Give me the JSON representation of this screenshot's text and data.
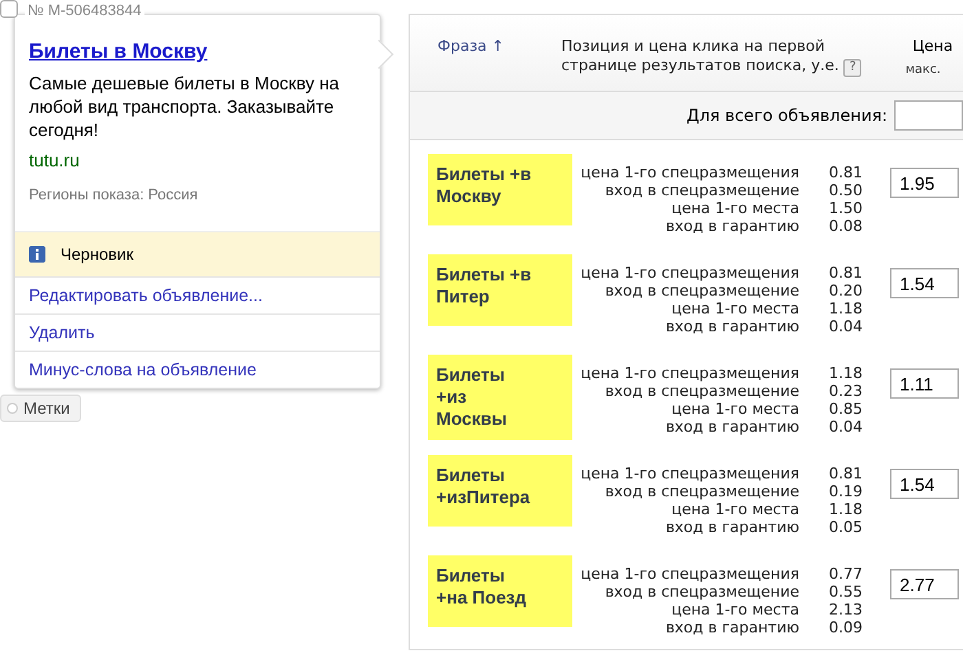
{
  "ad": {
    "checked": false,
    "number": "№ M-506483844",
    "title": "Билеты в Москву",
    "text": "Самые дешевые билеты в Москву на любой вид транспорта. Заказывайте сегодня!",
    "domain": "tutu.ru",
    "regions": "Регионы показа: Россия",
    "status": "Черновик",
    "actions": [
      "Редактировать объявление...",
      "Удалить",
      "Минус-слова на объявление"
    ]
  },
  "labels_button": "Метки",
  "table": {
    "columns": {
      "phrase": "Фраза",
      "sort_mark": "↑",
      "position": "Позиция и цена клика на первой странице результатов поиска, у.е.",
      "help": "?",
      "price": "Цена",
      "price_sub": "макс."
    },
    "all_ad_label": "Для всего объявления:",
    "rows": [
      {
        "phrase": "Билеты +в\nМоскву",
        "stats": [
          {
            "label": "цена 1-го спецразмещения",
            "value": "0.81"
          },
          {
            "label": "вход в спецразмещение",
            "value": "0.50"
          },
          {
            "label": "цена 1-го места",
            "value": "1.50"
          },
          {
            "label": "вход в гарантию",
            "value": "0.08"
          }
        ],
        "price": "1.95"
      },
      {
        "phrase": "Билеты +в\nПитер",
        "stats": [
          {
            "label": "цена 1-го спецразмещения",
            "value": "0.81"
          },
          {
            "label": "вход в спецразмещение",
            "value": "0.20"
          },
          {
            "label": "цена 1-го места",
            "value": "1.18"
          },
          {
            "label": "вход в гарантию",
            "value": "0.04"
          }
        ],
        "price": "1.54"
      },
      {
        "phrase": "Билеты\n+из\nМосквы",
        "stats": [
          {
            "label": "цена 1-го спецразмещения",
            "value": "1.18"
          },
          {
            "label": "вход в спецразмещение",
            "value": "0.23"
          },
          {
            "label": "цена 1-го места",
            "value": "0.85"
          },
          {
            "label": "вход в гарантию",
            "value": "0.04"
          }
        ],
        "price": "1.11"
      },
      {
        "phrase": "Билеты\n+изПитера",
        "stats": [
          {
            "label": "цена 1-го спецразмещения",
            "value": "0.81"
          },
          {
            "label": "вход в спецразмещение",
            "value": "0.19"
          },
          {
            "label": "цена 1-го места",
            "value": "1.18"
          },
          {
            "label": "вход в гарантию",
            "value": "0.05"
          }
        ],
        "price": "1.54"
      },
      {
        "phrase": "Билеты\n+на Поезд",
        "stats": [
          {
            "label": "цена 1-го спецразмещения",
            "value": "0.77"
          },
          {
            "label": "вход в спецразмещение",
            "value": "0.55"
          },
          {
            "label": "цена 1-го места",
            "value": "2.13"
          },
          {
            "label": "вход в гарантию",
            "value": "0.09"
          }
        ],
        "price": "2.77"
      }
    ]
  }
}
